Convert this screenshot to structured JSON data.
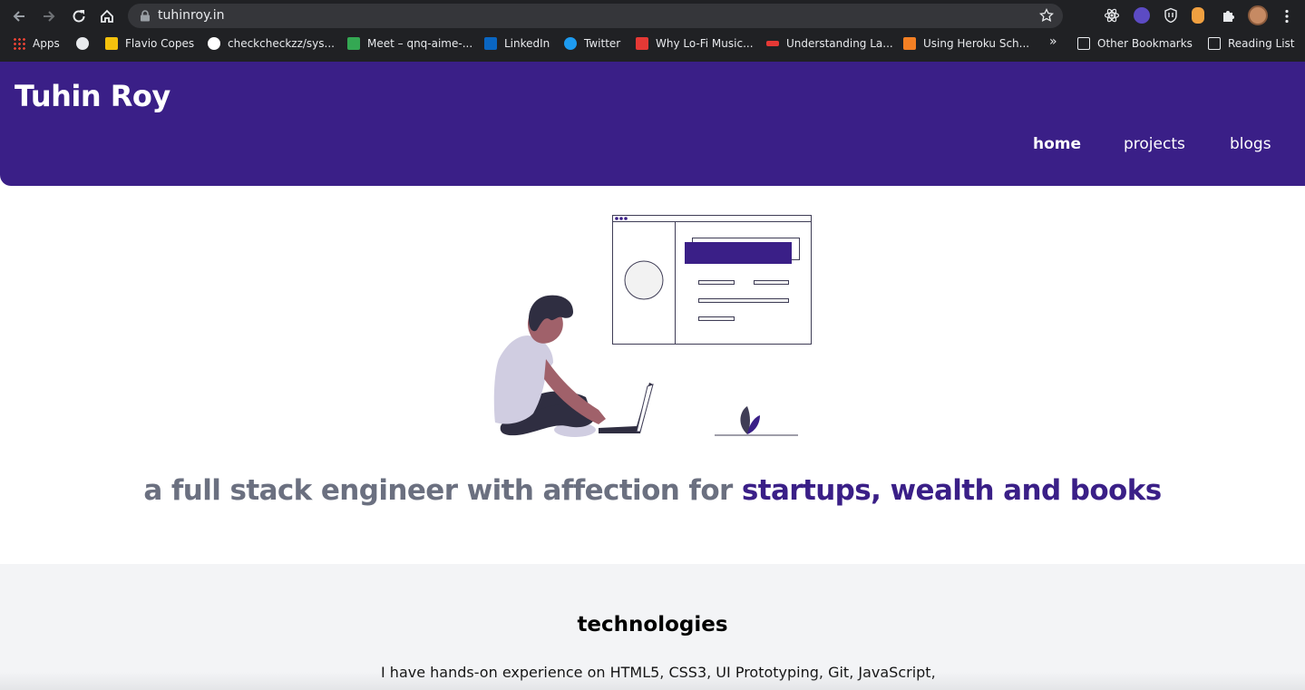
{
  "browser": {
    "url": "tuhinroy.in",
    "bookmarks": [
      {
        "label": "Apps",
        "color": "#e94235"
      },
      {
        "label": "",
        "color": "#e8eaed"
      },
      {
        "label": "Flavio Copes",
        "color": "#f4c20d"
      },
      {
        "label": "checkcheckzz/sys...",
        "color": "#ffffff"
      },
      {
        "label": "Meet – qnq-aime-...",
        "color": "#34a853"
      },
      {
        "label": "LinkedIn",
        "color": "#0a66c2"
      },
      {
        "label": "Twitter",
        "color": "#1d9bf0"
      },
      {
        "label": "Why Lo-Fi Music...",
        "color": "#e53935"
      },
      {
        "label": "Understanding La...",
        "color": "#e53935"
      },
      {
        "label": "Using Heroku Sch...",
        "color": "#f48024"
      }
    ],
    "overflow_label": "»",
    "other_bookmarks": "Other Bookmarks",
    "reading_list": "Reading List"
  },
  "site": {
    "title": "Tuhin Roy",
    "brand_color": "#3a1f87",
    "nav": [
      {
        "label": "home",
        "active": true
      },
      {
        "label": "projects",
        "active": false
      },
      {
        "label": "blogs",
        "active": false
      }
    ]
  },
  "hero": {
    "tagline_muted": "a full stack engineer with affection for",
    "tagline_accent": "startups, wealth and books"
  },
  "technologies": {
    "title": "technologies",
    "text": "I have hands-on experience on HTML5, CSS3, UI Prototyping, Git, JavaScript,"
  }
}
